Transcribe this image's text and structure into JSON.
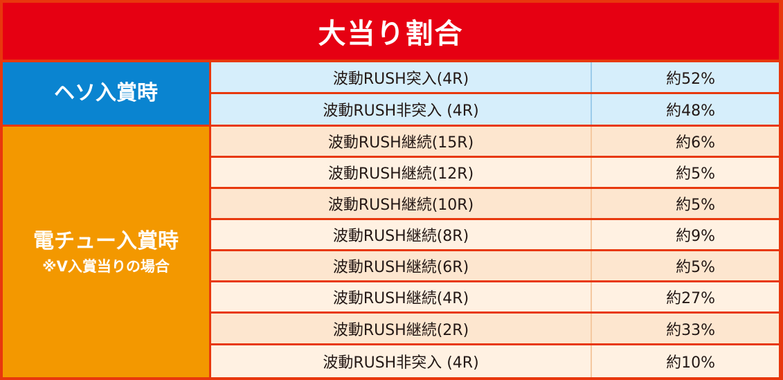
{
  "title": "大当り割合",
  "groups": [
    {
      "label": "ヘソ入賞時",
      "rows": [
        {
          "category": "波動RUSH突入(4R)",
          "value": "約52%"
        },
        {
          "category": "波動RUSH非突入 (4R)",
          "value": "約48%"
        }
      ]
    },
    {
      "label": "電チュー入賞時",
      "sublabel": "※V入賞当りの場合",
      "rows": [
        {
          "category": "波動RUSH継続(15R)",
          "value": "約6%"
        },
        {
          "category": "波動RUSH継続(12R)",
          "value": "約5%"
        },
        {
          "category": "波動RUSH継続(10R)",
          "value": "約5%"
        },
        {
          "category": "波動RUSH継続(8R)",
          "value": "約9%"
        },
        {
          "category": "波動RUSH継続(6R)",
          "value": "約5%"
        },
        {
          "category": "波動RUSH継続(4R)",
          "value": "約27%"
        },
        {
          "category": "波動RUSH継続(2R)",
          "value": "約33%"
        },
        {
          "category": "波動RUSH非突入 (4R)",
          "value": "約10%"
        }
      ]
    }
  ],
  "colors": {
    "header": "#e60012",
    "heso": "#0a84d0",
    "denchu": "#f39800",
    "border": "#e8380d"
  }
}
